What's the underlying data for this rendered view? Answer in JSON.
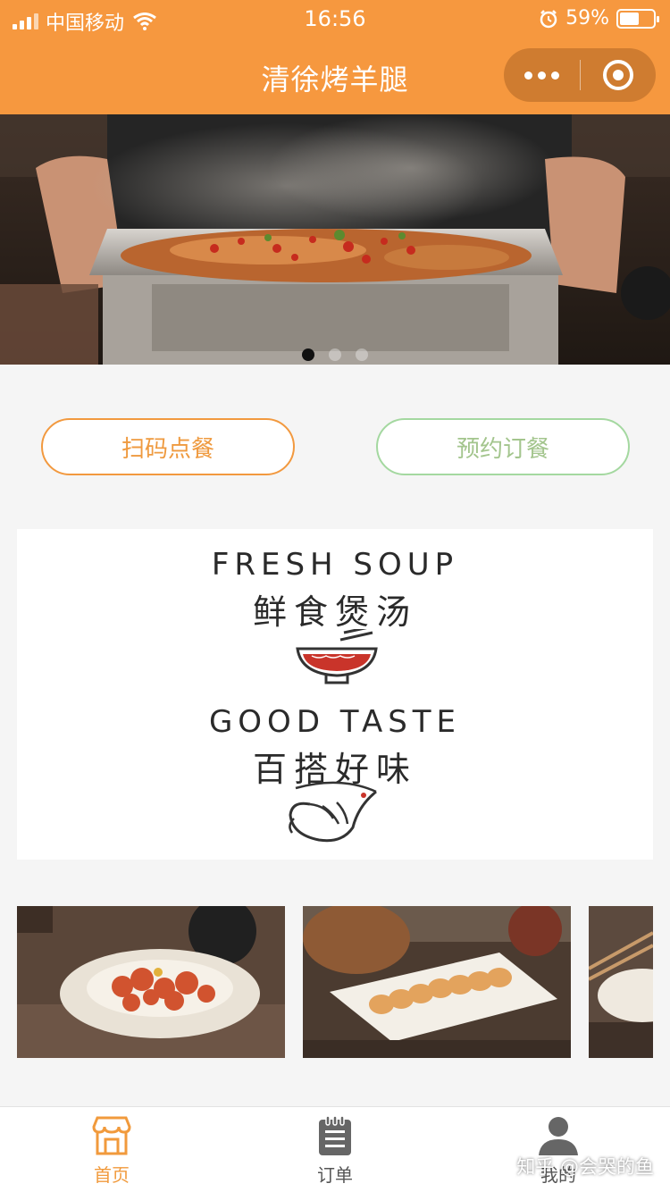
{
  "status_bar": {
    "carrier": "中国移动",
    "time": "16:56",
    "battery": "59%",
    "battery_level": 0.59
  },
  "header": {
    "title": "清徐烤羊腿",
    "more_icon": "more-dots-icon",
    "close_icon": "target-close-icon"
  },
  "banner": {
    "image": "grilled-fish-tray-photo",
    "page_count": 3,
    "active_page": 1
  },
  "actions": {
    "scan_order": "扫码点餐",
    "reserve": "预约订餐"
  },
  "promo": {
    "line1_en": "FRESH SOUP",
    "line1_zh": "鲜食煲汤",
    "line2_en": "GOOD TASTE",
    "line2_zh": "百搭好味",
    "bowl_icon": "soup-bowl-icon",
    "shrimp_icon": "shrimp-icon"
  },
  "gallery": {
    "items": [
      "sweet-sour-pork-photo",
      "sliced-sausage-plate-photo",
      "dish-photo-partial"
    ]
  },
  "tabbar": {
    "items": [
      {
        "label": "首页",
        "icon": "store-home-icon",
        "active": true
      },
      {
        "label": "订单",
        "icon": "order-notepad-icon",
        "active": false
      },
      {
        "label": "我的",
        "icon": "user-profile-icon",
        "active": false
      }
    ]
  },
  "watermark": "知乎 @会哭的鱼",
  "colors": {
    "brand": "#f6983f",
    "scan_border": "#f2993f",
    "reserve_border": "#a4d8a0",
    "tab_active": "#f19a3c"
  }
}
